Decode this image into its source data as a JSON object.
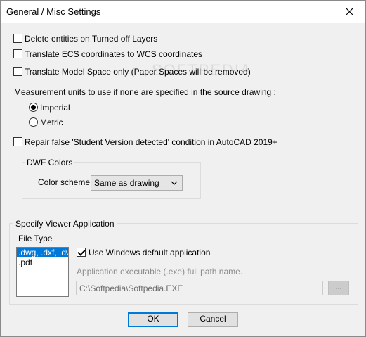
{
  "window": {
    "title": "General / Misc Settings"
  },
  "options": {
    "delete_entities": {
      "label": "Delete entities on Turned off Layers",
      "checked": false
    },
    "translate_ecs": {
      "label": "Translate ECS coordinates to WCS coordinates",
      "checked": false
    },
    "translate_model_space": {
      "label": "Translate Model Space only (Paper Spaces will be removed)",
      "checked": false
    }
  },
  "units": {
    "prompt": "Measurement units to use if none are specified in the source drawing :",
    "imperial": "Imperial",
    "metric": "Metric",
    "selected": "Imperial"
  },
  "repair": {
    "label": "Repair false 'Student Version detected' condition in AutoCAD 2019+",
    "checked": false
  },
  "dwf": {
    "group_title": "DWF Colors",
    "scheme_label": "Color scheme:",
    "scheme_value": "Same as drawing"
  },
  "viewer": {
    "group_title": "Specify Viewer Application",
    "file_type_label": "File Type",
    "file_types": [
      ".dwg, .dxf, .dwf",
      ".pdf"
    ],
    "use_default_label": "Use Windows default application",
    "use_default_checked": true,
    "exe_label": "Application executable (.exe) full path name.",
    "exe_path": "C:\\Softpedia\\Softpedia.EXE",
    "browse_label": "..."
  },
  "buttons": {
    "ok": "OK",
    "cancel": "Cancel"
  },
  "watermark": "SOFTPEDIA"
}
